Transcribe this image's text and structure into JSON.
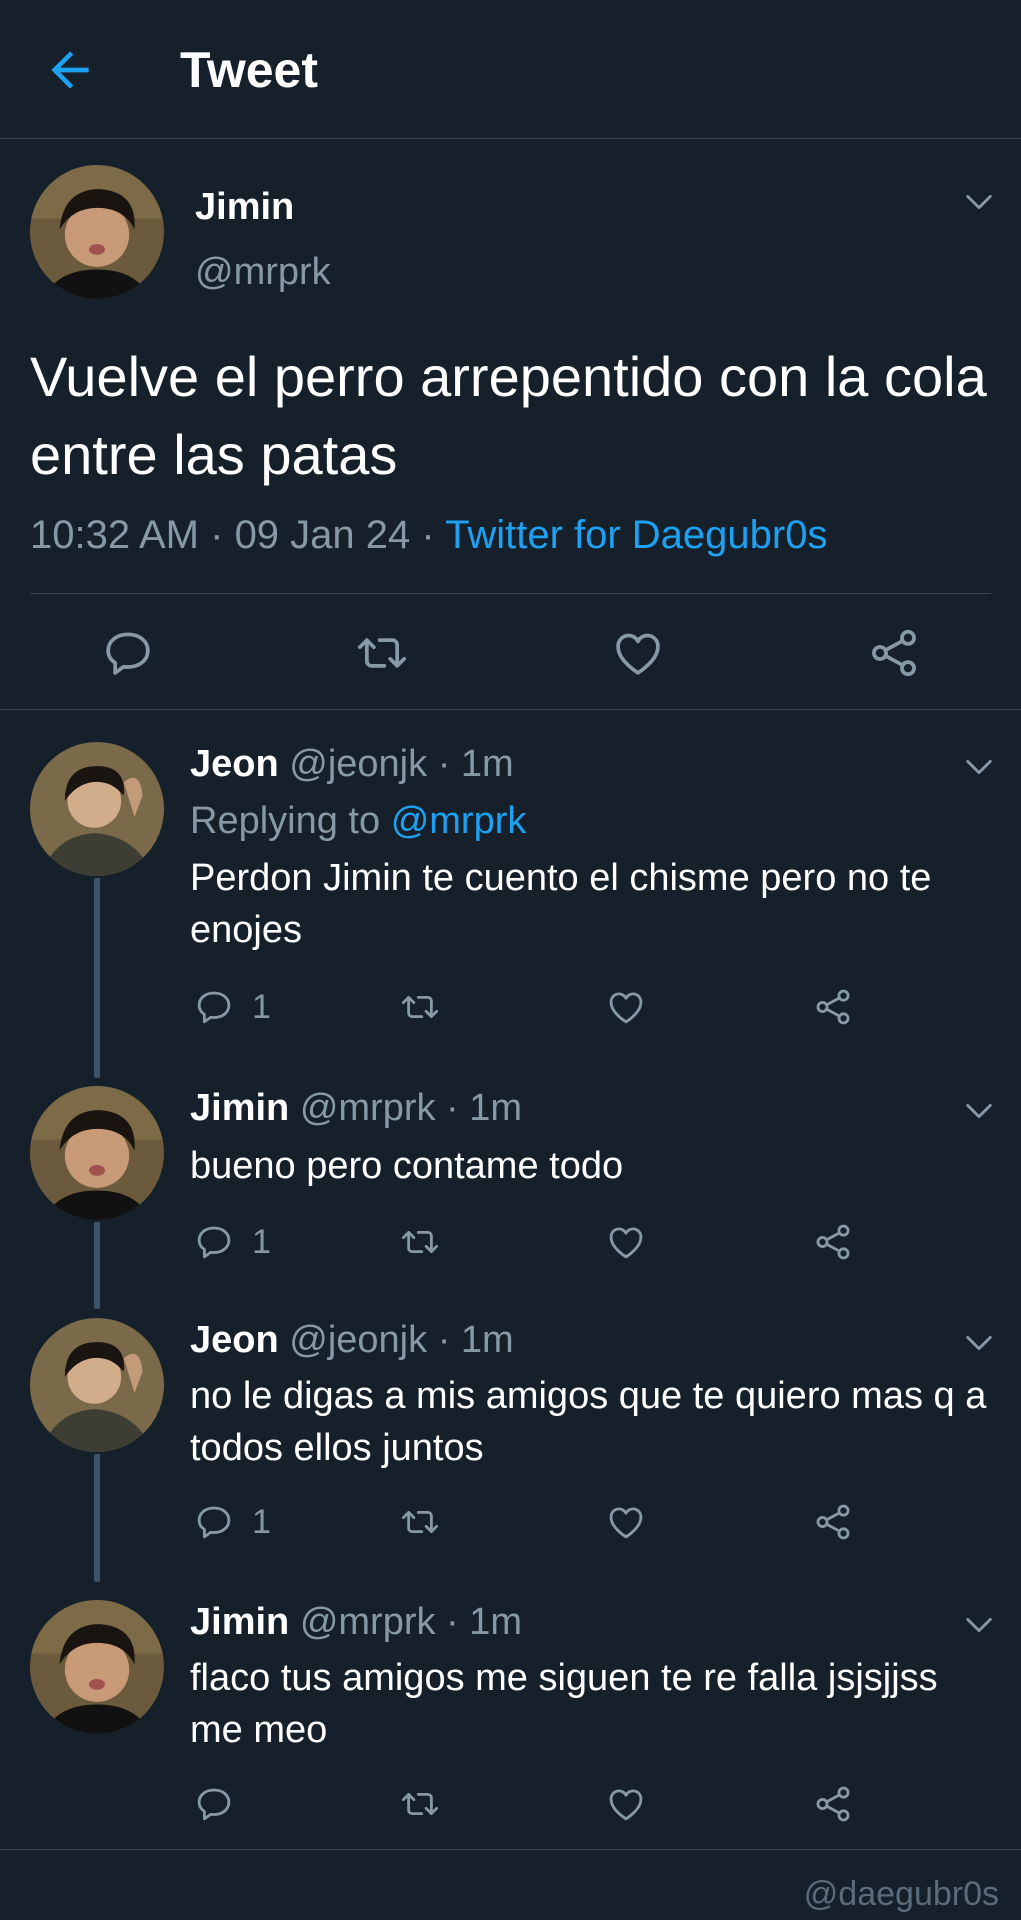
{
  "header": {
    "title": "Tweet"
  },
  "main_tweet": {
    "name": "Jimin",
    "handle": "@mrprk",
    "text": "Vuelve el perro arrepentido con la cola entre las patas",
    "time": "10:32 AM",
    "sep1": " · ",
    "date": "09 Jan 24",
    "sep2": " · ",
    "source": "Twitter for Daegubr0s"
  },
  "replies": [
    {
      "name": "Jeon",
      "handle": "@jeonjk",
      "time": "1m",
      "replying_label": "Replying to",
      "replying_to": "@mrprk",
      "text": "Perdon Jimin te cuento el chisme pero no te enojes",
      "reply_count": "1"
    },
    {
      "name": "Jimin",
      "handle": "@mrprk",
      "time": "1m",
      "text": "bueno pero contame todo",
      "reply_count": "1"
    },
    {
      "name": "Jeon",
      "handle": "@jeonjk",
      "time": "1m",
      "text": "no le digas a mis amigos que te quiero mas q a todos ellos juntos",
      "reply_count": "1"
    },
    {
      "name": "Jimin",
      "handle": "@mrprk",
      "time": "1m",
      "text": "flaco tus amigos me siguen te re falla jsjsjjss me meo",
      "reply_count": ""
    }
  ],
  "watermark": "@daegubr0s",
  "icons": {
    "back": "arrow-left-icon",
    "chevron": "chevron-down-icon",
    "reply": "reply-icon",
    "retweet": "retweet-icon",
    "like": "heart-icon",
    "share": "share-icon"
  },
  "colors": {
    "background": "#15202b",
    "accent": "#1da1f2",
    "secondary_text": "#8899a6",
    "divider": "#38444d",
    "icon": "#8899a6"
  }
}
